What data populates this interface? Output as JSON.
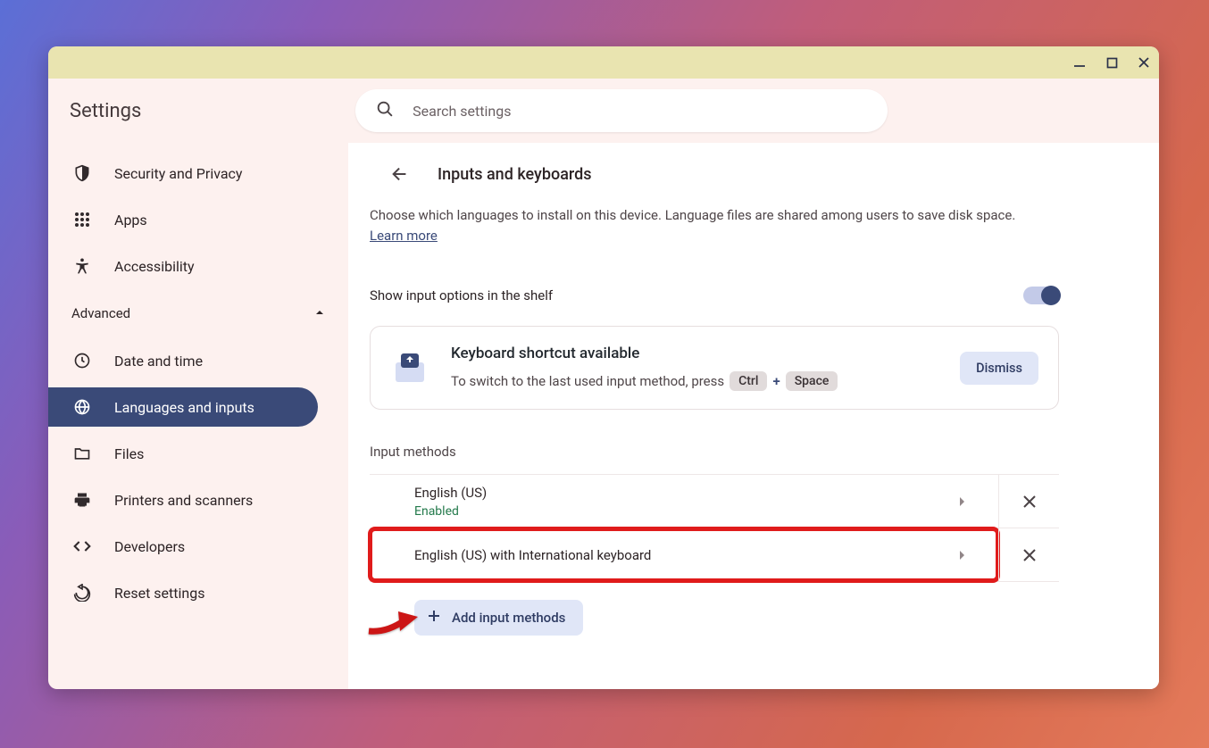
{
  "window": {
    "app_title": "Settings",
    "search_placeholder": "Search settings"
  },
  "sidebar": {
    "items": [
      {
        "id": "security-privacy",
        "label": "Security and Privacy",
        "icon": "shield"
      },
      {
        "id": "apps",
        "label": "Apps",
        "icon": "grid"
      },
      {
        "id": "accessibility",
        "label": "Accessibility",
        "icon": "person"
      }
    ],
    "advanced_label": "Advanced",
    "advanced_expanded": true,
    "advanced_items": [
      {
        "id": "date-time",
        "label": "Date and time",
        "icon": "clock"
      },
      {
        "id": "languages-inputs",
        "label": "Languages and inputs",
        "icon": "globe",
        "active": true
      },
      {
        "id": "files",
        "label": "Files",
        "icon": "folder"
      },
      {
        "id": "printers-scanners",
        "label": "Printers and scanners",
        "icon": "printer"
      },
      {
        "id": "developers",
        "label": "Developers",
        "icon": "code"
      },
      {
        "id": "reset-settings",
        "label": "Reset settings",
        "icon": "reset"
      }
    ]
  },
  "page": {
    "title": "Inputs and keyboards",
    "description": "Choose which languages to install on this device. Language files are shared among users to save disk space.",
    "learn_more": "Learn more",
    "shelf_setting_label": "Show input options in the shelf",
    "shelf_setting_on": true,
    "shortcut_card": {
      "title": "Keyboard shortcut available",
      "subtitle": "To switch to the last used input method, press",
      "key1": "Ctrl",
      "sep": "+",
      "key2": "Space",
      "dismiss": "Dismiss"
    },
    "input_methods_label": "Input methods",
    "input_methods": [
      {
        "name": "English (US)",
        "status": "Enabled"
      },
      {
        "name": "English (US) with International keyboard"
      }
    ],
    "add_button": "Add input methods"
  }
}
